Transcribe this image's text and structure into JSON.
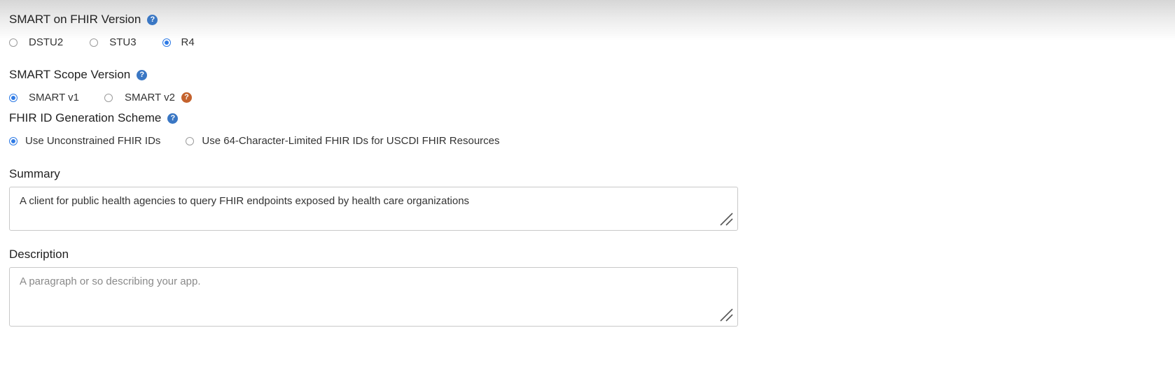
{
  "smart_version": {
    "title": "SMART on FHIR Version",
    "options": [
      {
        "label": "DSTU2",
        "checked": false
      },
      {
        "label": "STU3",
        "checked": false
      },
      {
        "label": "R4",
        "checked": true
      }
    ]
  },
  "scope_version": {
    "title": "SMART Scope Version",
    "options": [
      {
        "label": "SMART v1",
        "checked": true
      },
      {
        "label": "SMART v2",
        "checked": false
      }
    ]
  },
  "id_scheme": {
    "title": "FHIR ID Generation Scheme",
    "options": [
      {
        "label": "Use Unconstrained FHIR IDs",
        "checked": true
      },
      {
        "label": "Use 64-Character-Limited FHIR IDs for USCDI FHIR Resources",
        "checked": false
      }
    ]
  },
  "summary": {
    "label": "Summary",
    "value": "A client for public health agencies to query FHIR endpoints exposed by health care organizations",
    "placeholder": ""
  },
  "description": {
    "label": "Description",
    "value": "",
    "placeholder": "A paragraph or so describing your app."
  },
  "icons": {
    "help": "question-mark-circle-icon",
    "warning_help": "question-mark-circle-icon",
    "resize": "resize-grip-icon"
  },
  "colors": {
    "help_blue": "#3a77c4",
    "help_orange": "#c4622d",
    "radio_blue": "#2f7be5"
  }
}
